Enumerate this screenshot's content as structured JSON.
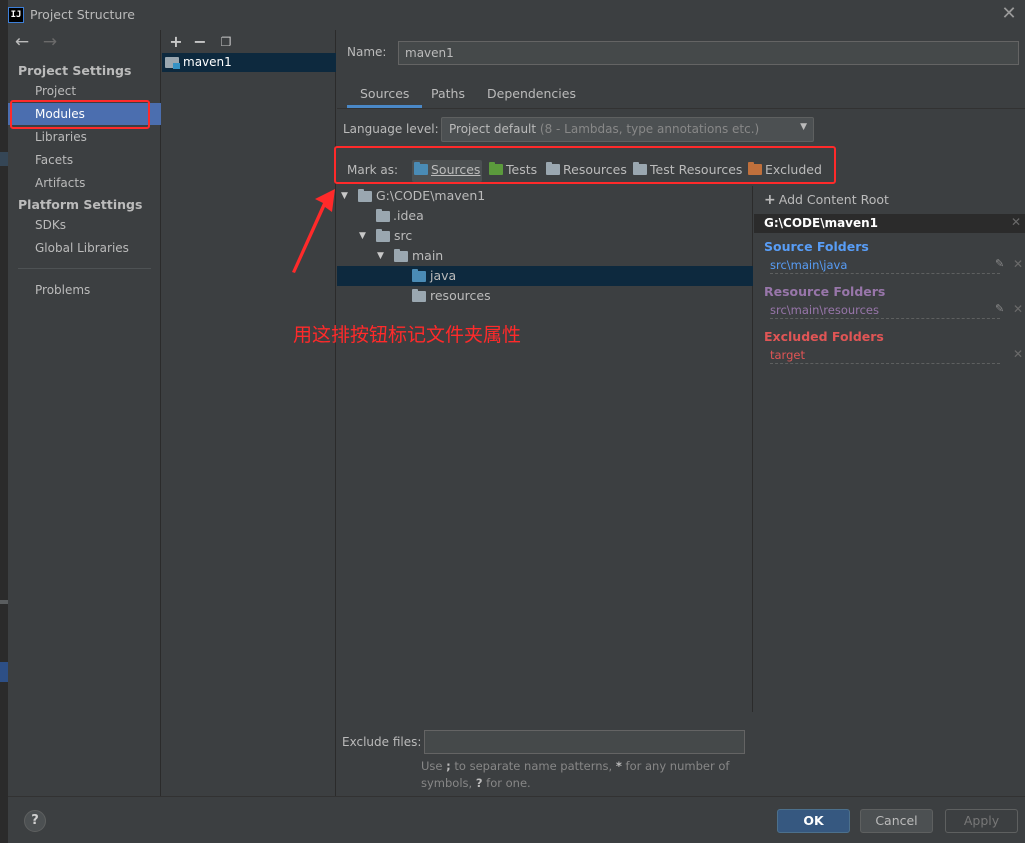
{
  "window": {
    "title": "Project Structure",
    "app_icon_text": "IJ"
  },
  "sidebar": {
    "section1": "Project Settings",
    "section1_items": [
      "Project",
      "Modules",
      "Libraries",
      "Facets",
      "Artifacts"
    ],
    "section2": "Platform Settings",
    "section2_items": [
      "SDKs",
      "Global Libraries"
    ],
    "problems": "Problems",
    "selected": "Modules"
  },
  "modules": {
    "items": [
      "maven1"
    ]
  },
  "main": {
    "name_label": "Name:",
    "name_value": "maven1",
    "tabs": [
      "Sources",
      "Paths",
      "Dependencies"
    ],
    "active_tab": "Sources",
    "language_label": "Language level:",
    "language_value": "Project default",
    "language_hint": " (8 - Lambdas, type annotations etc.)",
    "mark_as_label": "Mark as:",
    "mark_buttons": [
      {
        "label": "Sources",
        "color": "#4a8bb5"
      },
      {
        "label": "Tests",
        "color": "#5b9a3c"
      },
      {
        "label": "Resources",
        "color": "#9aa7b0"
      },
      {
        "label": "Test Resources",
        "color": "#9aa7b0"
      },
      {
        "label": "Excluded",
        "color": "#c0703c"
      }
    ],
    "tree": [
      {
        "label": "G:\\CODE\\maven1",
        "expanded": true
      },
      {
        "label": ".idea"
      },
      {
        "label": "src",
        "expanded": true
      },
      {
        "label": "main",
        "expanded": true
      },
      {
        "label": "java",
        "selected": true
      },
      {
        "label": "resources"
      }
    ],
    "annotation": "用这排按钮标记文件夹属性",
    "exclude_label": "Exclude files:",
    "exclude_hint_1": "Use ",
    "exclude_hint_semicolon": ";",
    "exclude_hint_2": " to separate name patterns, ",
    "exclude_hint_star": "*",
    "exclude_hint_3": " for any number of symbols, ",
    "exclude_hint_q": "?",
    "exclude_hint_4": " for one."
  },
  "content_root": {
    "add_label": "Add Content Root",
    "root_path": "G:\\CODE\\maven1",
    "source_heading": "Source Folders",
    "source_color": "#589df6",
    "source_entry": "src\\main\\java",
    "resource_heading": "Resource Folders",
    "resource_color": "#9876aa",
    "resource_entry": "src\\main\\resources",
    "excluded_heading": "Excluded Folders",
    "excluded_color": "#e05555",
    "excluded_entry": "target"
  },
  "footer": {
    "help": "?",
    "ok": "OK",
    "cancel": "Cancel",
    "apply": "Apply"
  }
}
